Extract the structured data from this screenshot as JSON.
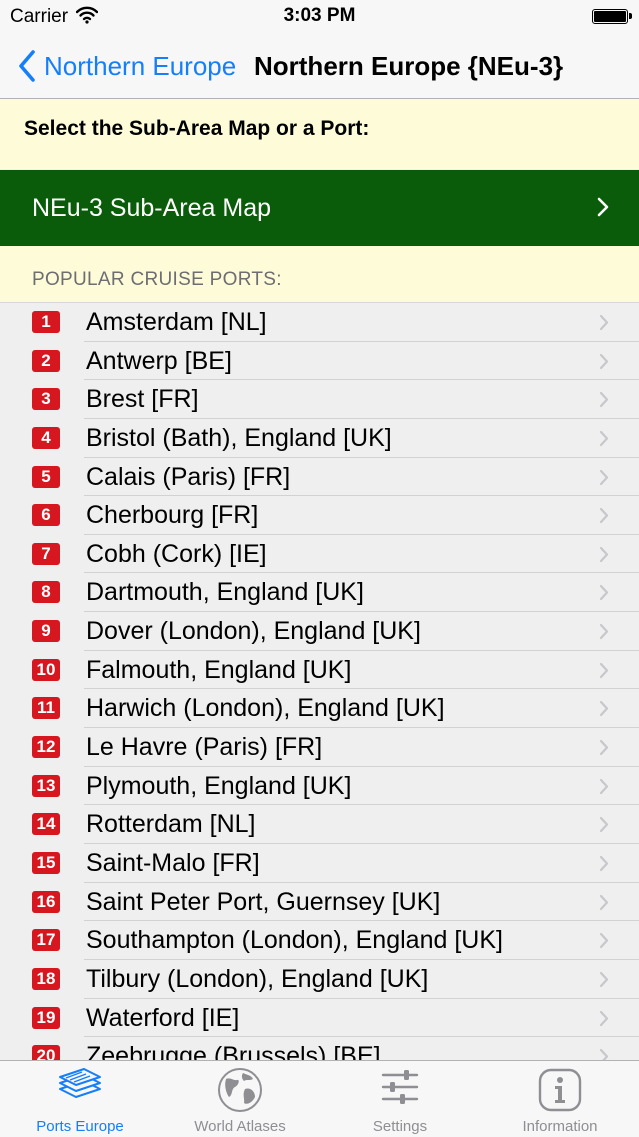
{
  "status_bar": {
    "carrier": "Carrier",
    "time": "3:03 PM"
  },
  "nav": {
    "back_label": "Northern Europe",
    "title": "Northern Europe {NEu-3}"
  },
  "prompt": "Select the Sub-Area Map or a Port:",
  "sub_area": {
    "label": "NEu-3 Sub-Area Map"
  },
  "section_header": "POPULAR CRUISE PORTS:",
  "colors": {
    "accent": "#157efb",
    "green_row": "#0a5c0a",
    "badge": "#d7171f",
    "highlight_bg": "#fdfbd8"
  },
  "ports": [
    {
      "num": "1",
      "name": "Amsterdam [NL]"
    },
    {
      "num": "2",
      "name": "Antwerp [BE]"
    },
    {
      "num": "3",
      "name": "Brest [FR]"
    },
    {
      "num": "4",
      "name": "Bristol (Bath), England [UK]"
    },
    {
      "num": "5",
      "name": "Calais (Paris) [FR]"
    },
    {
      "num": "6",
      "name": "Cherbourg [FR]"
    },
    {
      "num": "7",
      "name": "Cobh (Cork) [IE]"
    },
    {
      "num": "8",
      "name": "Dartmouth, England [UK]"
    },
    {
      "num": "9",
      "name": "Dover (London), England [UK]"
    },
    {
      "num": "10",
      "name": "Falmouth, England [UK]"
    },
    {
      "num": "11",
      "name": "Harwich (London), England [UK]"
    },
    {
      "num": "12",
      "name": "Le Havre (Paris) [FR]"
    },
    {
      "num": "13",
      "name": "Plymouth, England [UK]"
    },
    {
      "num": "14",
      "name": "Rotterdam [NL]"
    },
    {
      "num": "15",
      "name": "Saint-Malo [FR]"
    },
    {
      "num": "16",
      "name": "Saint Peter Port, Guernsey [UK]"
    },
    {
      "num": "17",
      "name": "Southampton (London), England [UK]"
    },
    {
      "num": "18",
      "name": "Tilbury (London), England [UK]"
    },
    {
      "num": "19",
      "name": "Waterford [IE]"
    },
    {
      "num": "20",
      "name": "Zeebrugge (Brussels) [BE]"
    }
  ],
  "tabs": [
    {
      "label": "Ports Europe",
      "icon": "layered-maps-icon",
      "active": true
    },
    {
      "label": "World Atlases",
      "icon": "globe-icon",
      "active": false
    },
    {
      "label": "Settings",
      "icon": "sliders-icon",
      "active": false
    },
    {
      "label": "Information",
      "icon": "info-icon",
      "active": false
    }
  ]
}
